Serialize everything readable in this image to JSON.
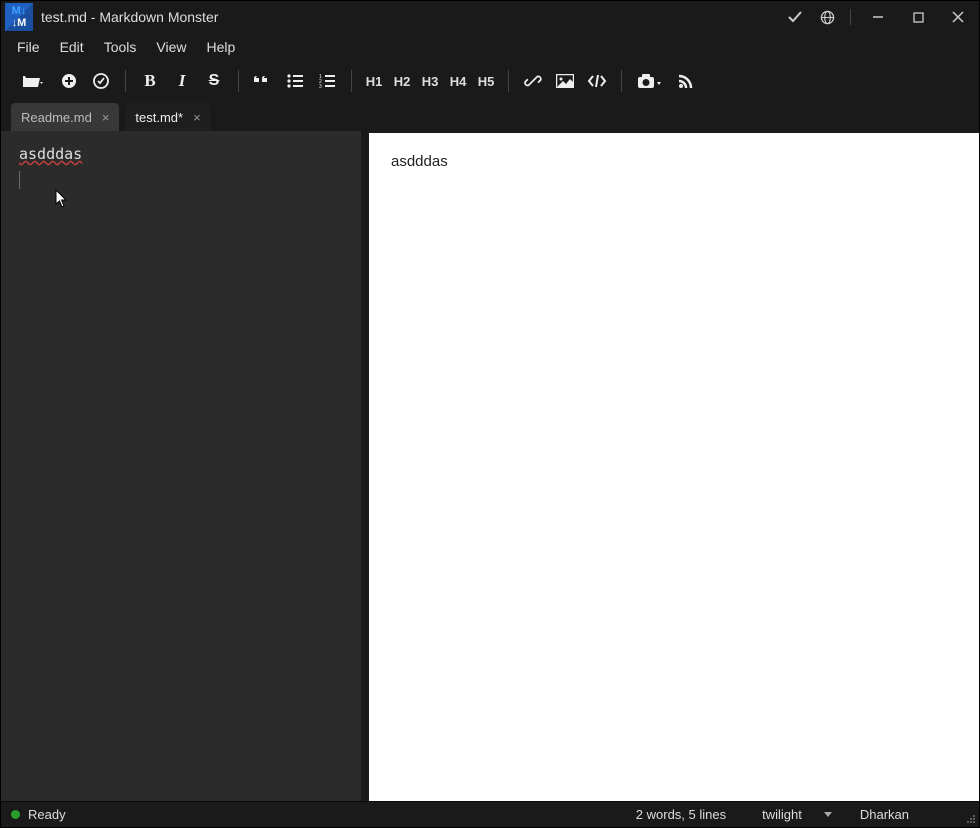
{
  "titlebar": {
    "title": "test.md  - Markdown Monster"
  },
  "menubar": {
    "items": [
      "File",
      "Edit",
      "Tools",
      "View",
      "Help"
    ]
  },
  "toolbar": {
    "headings": [
      "H1",
      "H2",
      "H3",
      "H4",
      "H5"
    ]
  },
  "tabs": [
    {
      "label": "Readme.md",
      "active": false
    },
    {
      "label": "test.md*",
      "active": true
    }
  ],
  "editor": {
    "content": "asdddas"
  },
  "preview": {
    "content": "asdddas"
  },
  "statusbar": {
    "state": "Ready",
    "stats": "2 words, 5 lines",
    "syntax_theme": "twilight",
    "preview_theme": "Dharkan"
  }
}
